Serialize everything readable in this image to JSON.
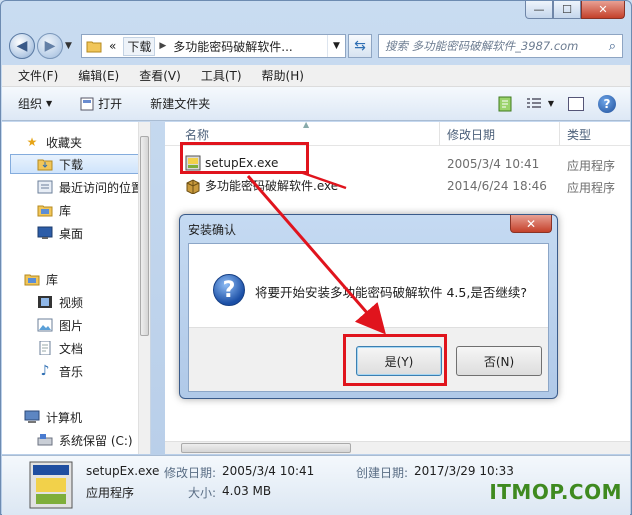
{
  "window": {
    "controls": {
      "minimize": "—",
      "maximize": "☐",
      "close": "✕"
    }
  },
  "address": {
    "path_prefix": "«",
    "path_segments": [
      "下载",
      "多功能密码破解软件..."
    ],
    "search_placeholder": "搜索 多功能密码破解软件_3987.com"
  },
  "menubar": [
    "文件(F)",
    "编辑(E)",
    "查看(V)",
    "工具(T)",
    "帮助(H)"
  ],
  "commandbar": {
    "organize": "组织",
    "open": "打开",
    "new_folder": "新建文件夹"
  },
  "nav": {
    "favorites": "收藏夹",
    "downloads": "下载",
    "recent": "最近访问的位置",
    "library_short": "库",
    "desktop": "桌面",
    "libraries": "库",
    "videos": "视频",
    "pictures": "图片",
    "documents": "文档",
    "music": "音乐",
    "computer": "计算机",
    "system_drive": "系统保留 (C:)"
  },
  "columns": {
    "name": "名称",
    "modified": "修改日期",
    "type": "类型"
  },
  "files": [
    {
      "name": "setupEx.exe",
      "modified": "2005/3/4 10:41",
      "type": "应用程序"
    },
    {
      "name": "多功能密码破解软件.exe",
      "modified": "2014/6/24 18:46",
      "type": "应用程序"
    }
  ],
  "details": {
    "name": "setupEx.exe",
    "type": "应用程序",
    "modified_label": "修改日期:",
    "modified_value": "2005/3/4 10:41",
    "size_label": "大小:",
    "size_value": "4.03 MB",
    "created_label": "创建日期:",
    "created_value": "2017/3/29 10:33"
  },
  "dialog": {
    "title": "安装确认",
    "message": "将要开始安装多功能密码破解软件 4.5,是否继续?",
    "yes_label": "是(Y)",
    "no_label": "否(N)",
    "close": "✕"
  },
  "watermark": "ITMOP.COM",
  "colors": {
    "highlight": "#e0141d",
    "watermark": "#3f8a20",
    "accent": "#1b4fa6"
  }
}
